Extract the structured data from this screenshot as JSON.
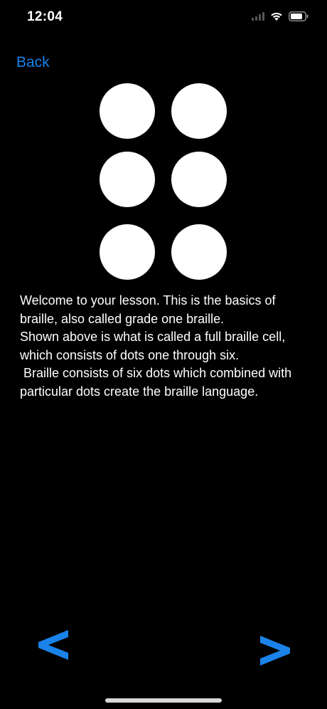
{
  "status_bar": {
    "time": "12:04"
  },
  "navigation": {
    "back_label": "Back"
  },
  "braille_cell": {
    "dots": [
      1,
      2,
      3,
      4,
      5,
      6
    ],
    "dot_color": "#ffffff"
  },
  "lesson": {
    "text": "Welcome to your lesson. This is the basics of braille, also called grade one braille.\nShown above is what is called a full braille cell, which consists of dots one through six.\n Braille consists of six dots which combined with particular dots create the braille language."
  },
  "pager": {
    "prev_icon": "chevron-left-icon",
    "next_icon": "chevron-right-icon",
    "accent_color": "#1a82e8"
  }
}
